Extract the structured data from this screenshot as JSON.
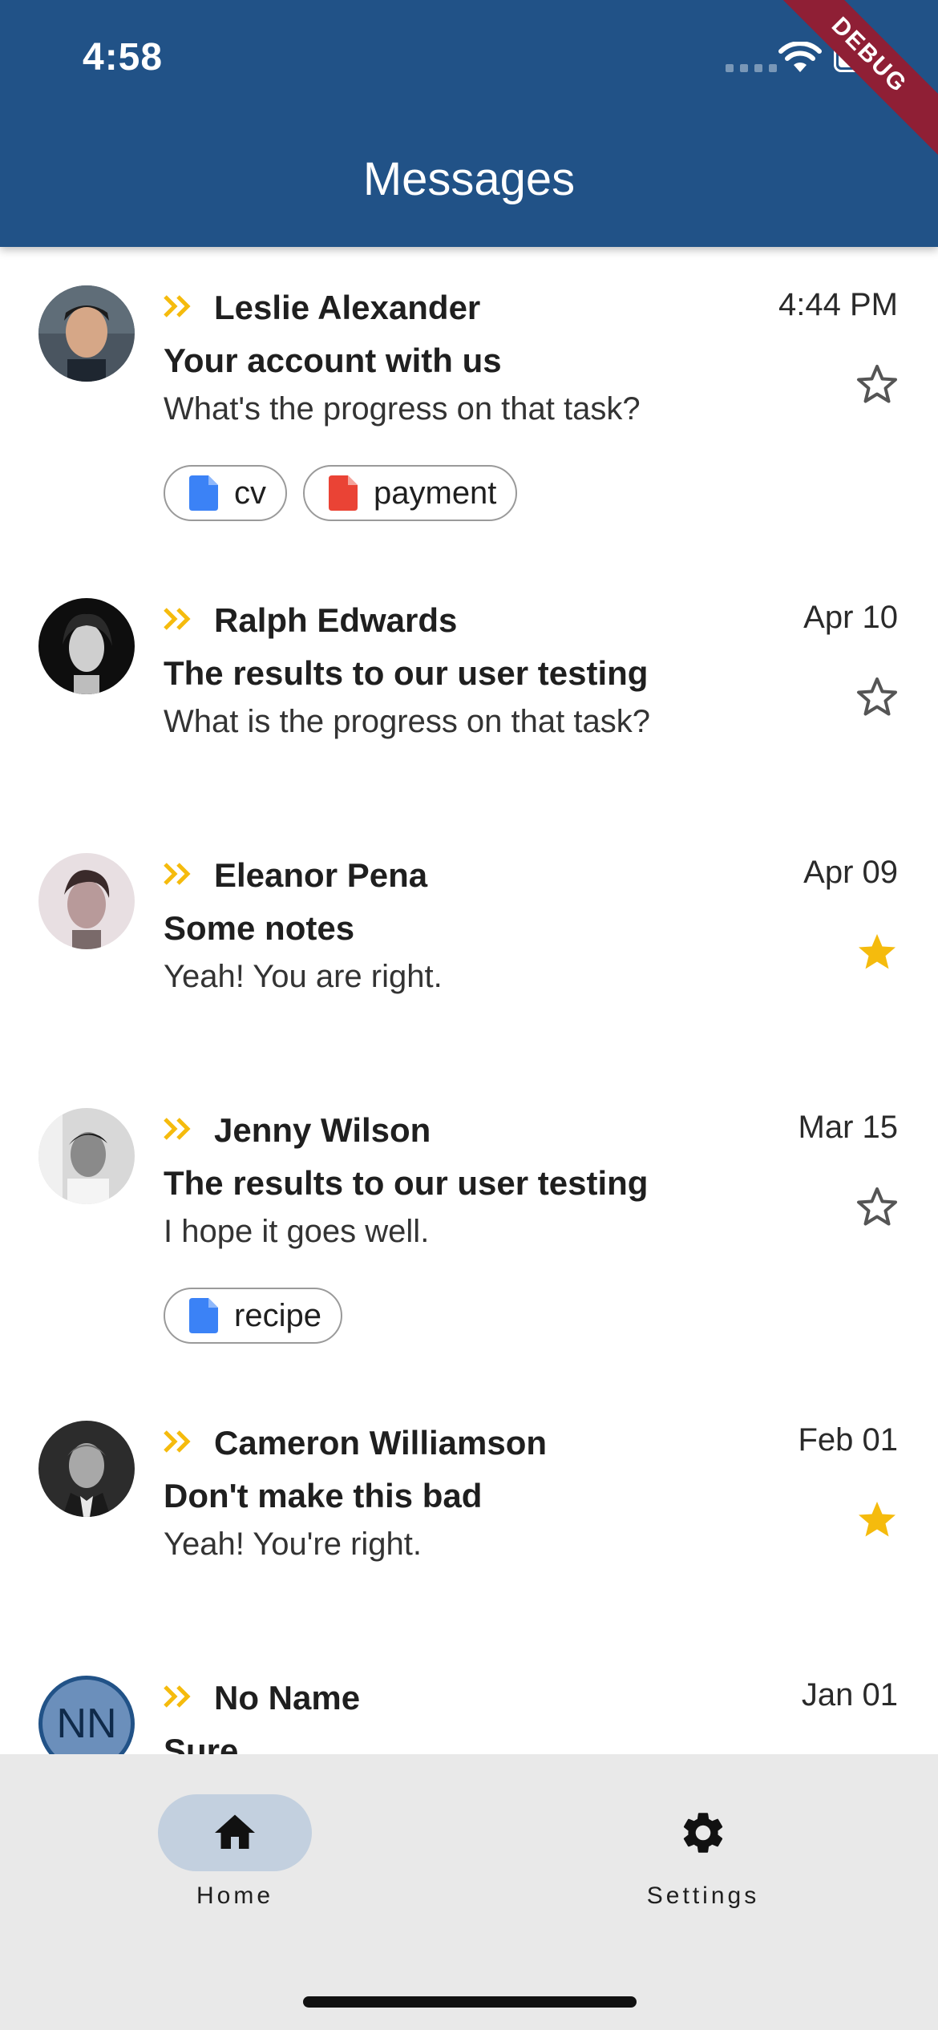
{
  "status_bar": {
    "time": "4:58",
    "debug_label": "DEBUG"
  },
  "app_bar": {
    "title": "Messages"
  },
  "colors": {
    "primary": "#215287",
    "star_filled": "#F5BB0D",
    "forward_accent": "#F5BB0D",
    "chip_doc_blue": "#3B82F6",
    "chip_doc_red": "#EA4335",
    "nav_active": "#C3D0DF"
  },
  "messages": [
    {
      "sender": "Leslie Alexander",
      "date": "4:44 PM",
      "subject": "Your account with us",
      "preview": "What's the progress on that task?",
      "starred": false,
      "chips": [
        {
          "label": "cv",
          "icon": "doc-blue-icon"
        },
        {
          "label": "payment",
          "icon": "doc-red-icon"
        }
      ]
    },
    {
      "sender": "Ralph Edwards",
      "date": "Apr 10",
      "subject": "The results to our user testing",
      "preview": "What is the progress on that task?",
      "starred": false,
      "chips": []
    },
    {
      "sender": "Eleanor Pena",
      "date": "Apr 09",
      "subject": "Some notes",
      "preview": "Yeah! You are right.",
      "starred": true,
      "chips": []
    },
    {
      "sender": "Jenny Wilson",
      "date": "Mar 15",
      "subject": "The results to our user testing",
      "preview": "I hope it goes well.",
      "starred": false,
      "chips": [
        {
          "label": "recipe",
          "icon": "doc-blue-icon"
        }
      ]
    },
    {
      "sender": "Cameron Williamson",
      "date": "Feb 01",
      "subject": "Don't make this bad",
      "preview": "Yeah! You're right.",
      "starred": true,
      "chips": []
    },
    {
      "sender": "No Name",
      "date": "Jan 01",
      "subject": "Sure",
      "preview": "",
      "starred": true,
      "avatar_initials": "NN",
      "chips": []
    }
  ],
  "bottom_nav": {
    "items": [
      {
        "label": "Home",
        "icon": "home-icon",
        "active": true
      },
      {
        "label": "Settings",
        "icon": "gear-icon",
        "active": false
      }
    ]
  }
}
